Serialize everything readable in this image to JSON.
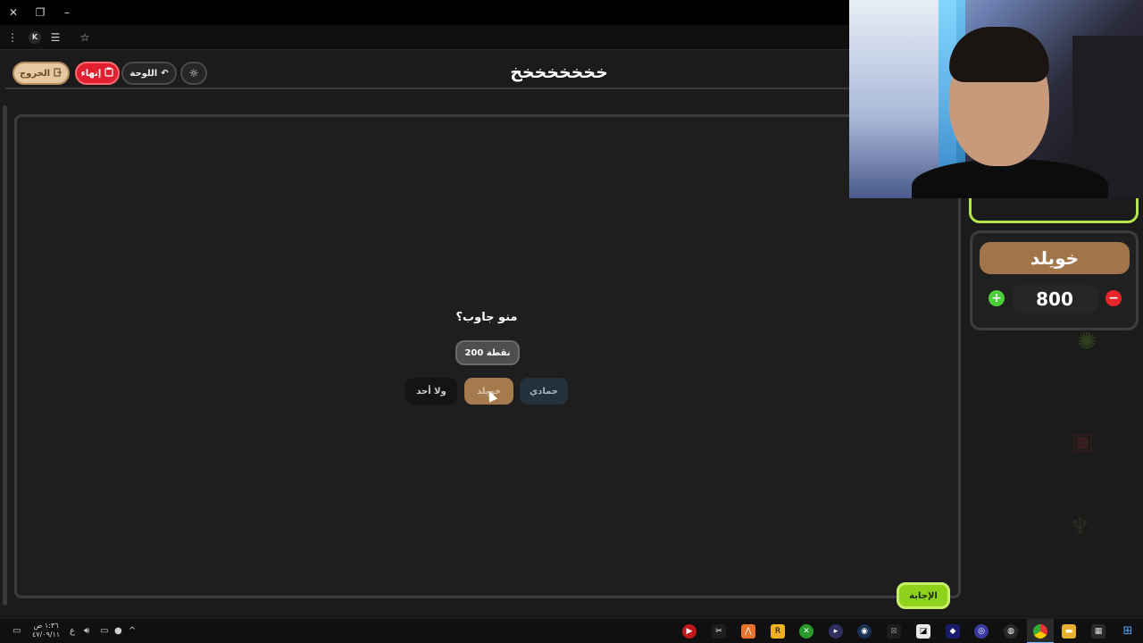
{
  "app": {
    "title": "خخخخخخخخ",
    "exit_label": "الخروج",
    "end_label": "إنهاء",
    "board_label": "اللوحة"
  },
  "question": {
    "prompt": "منو جاوب؟",
    "points": "200 نقطة",
    "choices": {
      "none": "ولا أحد",
      "team_b": "خويلد",
      "team_a": "حمادي"
    }
  },
  "answer_button": "الإجابة",
  "team": {
    "name": "خويلد",
    "score": "800",
    "plus": "+",
    "minus": "−"
  },
  "taskbar": {
    "clock_time": "١:٣٦ ص",
    "clock_date": "٤٧/٠٩/١١",
    "lang": "ع"
  },
  "icons": {
    "exit": "exit-icon",
    "end": "clipboard-icon",
    "board": "undo-icon",
    "theme": "sun-icon"
  },
  "colors": {
    "exit_bg": "#e6c9a3",
    "end_bg": "#e02030",
    "answer_bg": "#8fd21c",
    "team_name_bg": "#a27548",
    "team1_border": "#b6e64a"
  }
}
